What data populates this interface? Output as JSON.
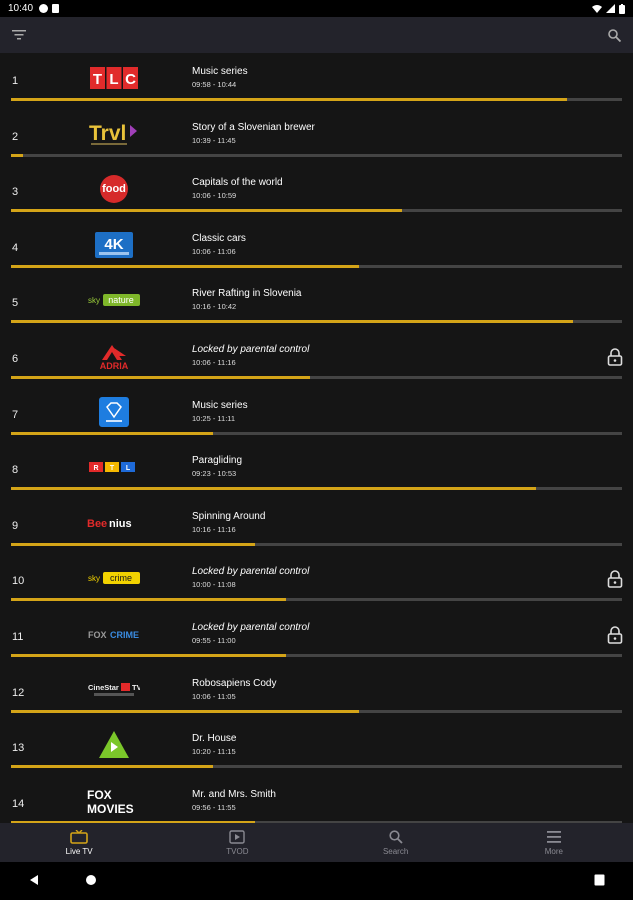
{
  "status_bar": {
    "time": "10:40"
  },
  "app_bar": {
    "filter_icon": "filter-icon",
    "search_icon": "search-icon"
  },
  "channels": [
    {
      "number": "1",
      "logo": "TLC",
      "title": "Music series",
      "time": "09:58 - 10:44",
      "locked": false,
      "progress": 0.91
    },
    {
      "number": "2",
      "logo": "Trvl",
      "title": "Story of a Slovenian brewer",
      "time": "10:39 - 11:45",
      "locked": false,
      "progress": 0.02
    },
    {
      "number": "3",
      "logo": "food",
      "title": "Capitals of the world",
      "time": "10:06 - 10:59",
      "locked": false,
      "progress": 0.64
    },
    {
      "number": "4",
      "logo": "4K",
      "title": "Classic cars",
      "time": "10:06 - 11:06",
      "locked": false,
      "progress": 0.57
    },
    {
      "number": "5",
      "logo": "sky nature",
      "title": "River Rafting in Slovenia",
      "time": "10:16 - 10:42",
      "locked": false,
      "progress": 0.92
    },
    {
      "number": "6",
      "logo": "ADRIA",
      "title": "Locked by parental control",
      "time": "10:06 - 11:16",
      "locked": true,
      "progress": 0.49
    },
    {
      "number": "7",
      "logo": "diamond",
      "title": "Music series",
      "time": "10:25 - 11:11",
      "locked": false,
      "progress": 0.33
    },
    {
      "number": "8",
      "logo": "RTL",
      "title": "Paragliding",
      "time": "09:23 - 10:53",
      "locked": false,
      "progress": 0.86
    },
    {
      "number": "9",
      "logo": "Beenius",
      "title": "Spinning Around",
      "time": "10:16 - 11:16",
      "locked": false,
      "progress": 0.4
    },
    {
      "number": "10",
      "logo": "sky crime",
      "title": "Locked by parental control",
      "time": "10:00 - 11:08",
      "locked": true,
      "progress": 0.45
    },
    {
      "number": "11",
      "logo": "FOXCRIME",
      "title": "Locked by parental control",
      "time": "09:55 - 11:00",
      "locked": true,
      "progress": 0.45
    },
    {
      "number": "12",
      "logo": "CineStar TV",
      "title": "Robosapiens Cody",
      "time": "10:06 - 11:05",
      "locked": false,
      "progress": 0.57
    },
    {
      "number": "13",
      "logo": "play",
      "title": "Dr. House",
      "time": "10:20 - 11:15",
      "locked": false,
      "progress": 0.33
    },
    {
      "number": "14",
      "logo": "FOX MOVIES",
      "title": "Mr. and Mrs. Smith",
      "time": "09:56 - 11:55",
      "locked": false,
      "progress": 0.4
    }
  ],
  "nav": [
    {
      "label": "Live TV",
      "icon": "tv-icon",
      "active": true
    },
    {
      "label": "TVOD",
      "icon": "play-square-icon",
      "active": false
    },
    {
      "label": "Search",
      "icon": "search-icon",
      "active": false
    },
    {
      "label": "More",
      "icon": "menu-icon",
      "active": false
    }
  ],
  "colors": {
    "accent": "#d4a418",
    "background": "#151515",
    "bar": "#23232b"
  }
}
